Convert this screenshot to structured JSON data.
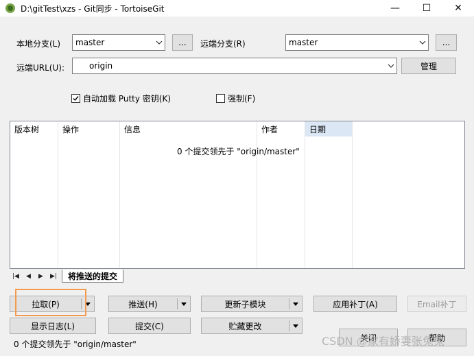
{
  "window": {
    "title": "D:\\gitTest\\xzs - Git同步 - TortoiseGit",
    "minimize_glyph": "—",
    "maximize_glyph": "☐",
    "close_glyph": "✕"
  },
  "branches": {
    "local_label": "本地分支(L)",
    "local_value": "master",
    "remote_label": "远端分支(R)",
    "remote_value": "master",
    "browse_label": "...",
    "url_label": "远端URL(U):",
    "url_value": "origin",
    "manage_label": "管理"
  },
  "options": {
    "autoload_label": "自动加载 Putty 密钥(K)",
    "autoload_checked": true,
    "force_label": "强制(F)",
    "force_checked": false
  },
  "list": {
    "columns": [
      "版本树",
      "操作",
      "信息",
      "作者",
      "日期"
    ],
    "empty_message": "0 个提交领先于 \"origin/master\""
  },
  "tabs": {
    "nav_first": "|◀",
    "nav_prev": "◀",
    "nav_next": "▶",
    "nav_last": "▶|",
    "active": "将推送的提交"
  },
  "buttons": {
    "pull": "拉取(P)",
    "push": "推送(H)",
    "submodule": "更新子模块",
    "apply_patch": "应用补丁(A)",
    "email_patch": "Email补丁",
    "show_log": "显示日志(L)",
    "commit": "提交(C)",
    "stash": "贮藏更改",
    "close": "关闭",
    "help": "帮助"
  },
  "status_text": "0 个提交领先于 \"origin/master\"",
  "watermark": "CSDN @家有娇妻张兔兔"
}
